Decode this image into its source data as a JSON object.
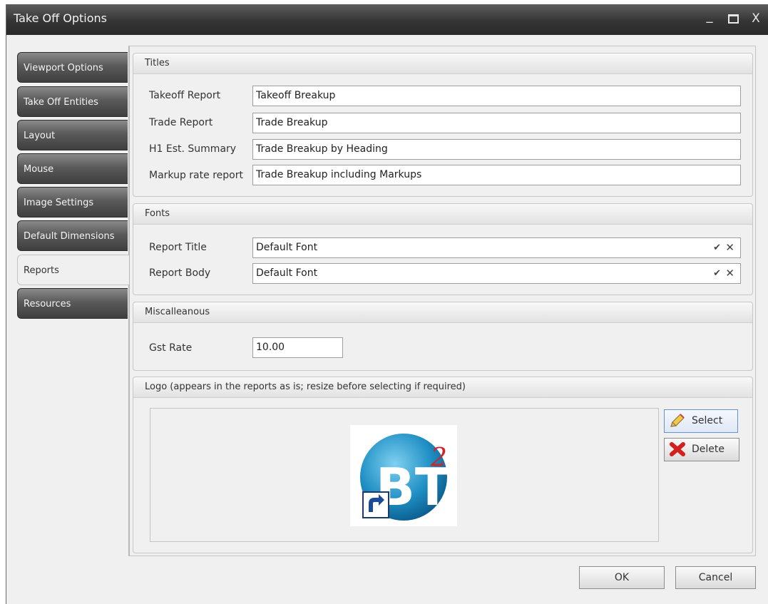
{
  "window": {
    "title": "Take Off Options",
    "min_glyph": "_",
    "close_glyph": "X"
  },
  "tabs": [
    {
      "label": "Viewport Options"
    },
    {
      "label": "Take Off Entities"
    },
    {
      "label": "Layout"
    },
    {
      "label": "Mouse"
    },
    {
      "label": "Image Settings"
    },
    {
      "label": "Default Dimensions"
    },
    {
      "label": "Reports",
      "active": true
    },
    {
      "label": "Resources"
    }
  ],
  "titles": {
    "header": "Titles",
    "takeoff_report": {
      "label": "Takeoff Report",
      "value": "Takeoff Breakup"
    },
    "trade_report": {
      "label": "Trade Report",
      "value": "Trade Breakup"
    },
    "h1_summary": {
      "label": "H1 Est. Summary",
      "value": "Trade Breakup by Heading"
    },
    "markup_report": {
      "label": "Markup rate report",
      "value": "Trade Breakup including Markups"
    }
  },
  "fonts": {
    "header": "Fonts",
    "report_title": {
      "label": "Report Title",
      "value": "Default Font"
    },
    "report_body": {
      "label": "Report Body",
      "value": "Default Font"
    },
    "accept_glyph": "✔",
    "clear_glyph": "✕"
  },
  "misc": {
    "header": "Miscalleanous",
    "gst_rate": {
      "label": "Gst Rate",
      "value": "10.00"
    }
  },
  "logo": {
    "header": "Logo (appears in the reports as is; resize before selecting if required)",
    "select_label": "Select",
    "delete_label": "Delete",
    "logo_text": "BT",
    "logo_superscript": "2"
  },
  "footer": {
    "ok_label": "OK",
    "cancel_label": "Cancel"
  },
  "colors": {
    "titlebar": "#353535",
    "logo_blue": "#1f8fc4",
    "logo_red": "#d0242a"
  }
}
